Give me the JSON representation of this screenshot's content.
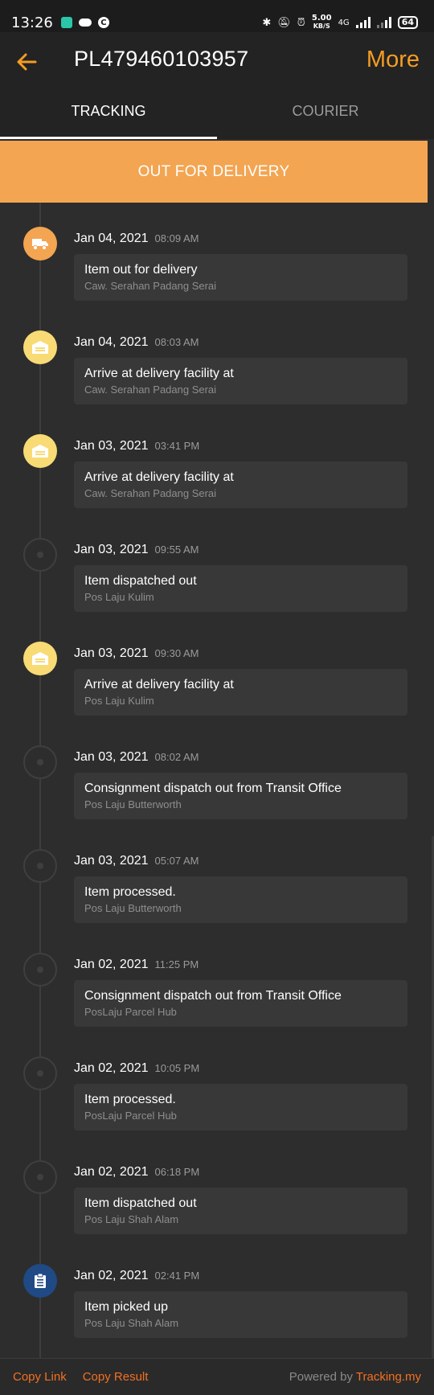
{
  "status_bar": {
    "time": "13:26",
    "speed_value": "5.00",
    "speed_unit": "KB/S",
    "network": "4G",
    "battery": "64"
  },
  "header": {
    "title": "PL479460103957",
    "more_label": "More"
  },
  "tabs": [
    {
      "label": "TRACKING",
      "active": true
    },
    {
      "label": "COURIER",
      "active": false
    }
  ],
  "banner": {
    "status": "OUT FOR DELIVERY",
    "color": "#f3a552"
  },
  "events": [
    {
      "date": "Jan 04, 2021",
      "time": "08:09 AM",
      "title": "Item out for delivery",
      "location": "Caw. Serahan Padang Serai",
      "icon": "truck-icon",
      "color": "orange"
    },
    {
      "date": "Jan 04, 2021",
      "time": "08:03 AM",
      "title": "Arrive at delivery facility at",
      "location": "Caw. Serahan Padang Serai",
      "icon": "warehouse-icon",
      "color": "yellow"
    },
    {
      "date": "Jan 03, 2021",
      "time": "03:41 PM",
      "title": "Arrive at delivery facility at",
      "location": "Caw. Serahan Padang Serai",
      "icon": "warehouse-icon",
      "color": "yellow"
    },
    {
      "date": "Jan 03, 2021",
      "time": "09:55 AM",
      "title": "Item dispatched out",
      "location": "Pos Laju Kulim",
      "icon": "dot-icon",
      "color": "grey"
    },
    {
      "date": "Jan 03, 2021",
      "time": "09:30 AM",
      "title": "Arrive at delivery facility at",
      "location": "Pos Laju Kulim",
      "icon": "warehouse-icon",
      "color": "yellow"
    },
    {
      "date": "Jan 03, 2021",
      "time": "08:02 AM",
      "title": "Consignment dispatch out from Transit Office",
      "location": "Pos Laju Butterworth",
      "icon": "dot-icon",
      "color": "grey"
    },
    {
      "date": "Jan 03, 2021",
      "time": "05:07 AM",
      "title": "Item processed.",
      "location": "Pos Laju Butterworth",
      "icon": "dot-icon",
      "color": "grey"
    },
    {
      "date": "Jan 02, 2021",
      "time": "11:25 PM",
      "title": "Consignment dispatch out from Transit Office",
      "location": "PosLaju Parcel Hub",
      "icon": "dot-icon",
      "color": "grey"
    },
    {
      "date": "Jan 02, 2021",
      "time": "10:05 PM",
      "title": "Item processed.",
      "location": "PosLaju Parcel Hub",
      "icon": "dot-icon",
      "color": "grey"
    },
    {
      "date": "Jan 02, 2021",
      "time": "06:18 PM",
      "title": "Item dispatched out",
      "location": "Pos Laju Shah Alam",
      "icon": "dot-icon",
      "color": "grey"
    },
    {
      "date": "Jan 02, 2021",
      "time": "02:41 PM",
      "title": "Item picked up",
      "location": "Pos Laju Shah Alam",
      "icon": "clipboard-icon",
      "color": "blue"
    }
  ],
  "footer": {
    "copy_link": "Copy Link",
    "copy_result": "Copy Result",
    "powered_by": "Powered by",
    "brand": "Tracking.my"
  }
}
